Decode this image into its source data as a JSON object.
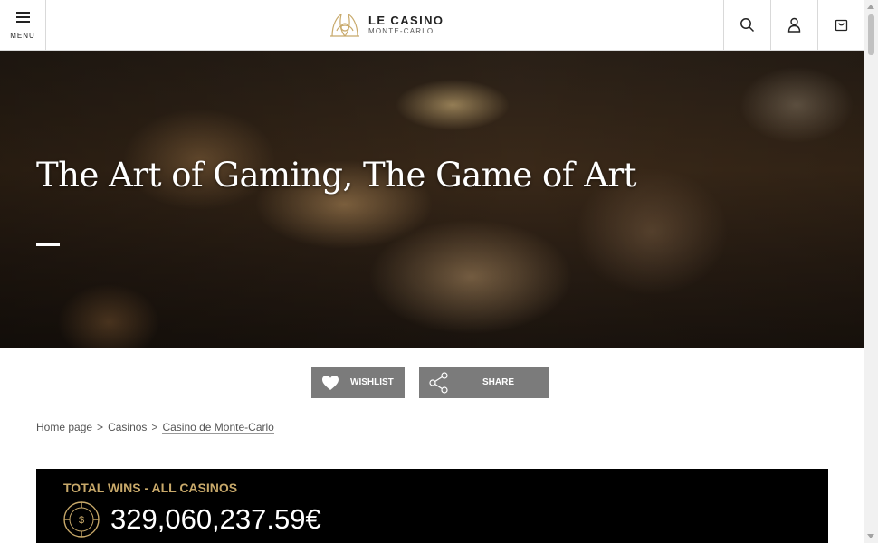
{
  "header": {
    "menu_label": "MENU",
    "logo_title": "LE CASINO",
    "logo_subtitle": "MONTE-CARLO",
    "icons": [
      "search-icon",
      "user-icon",
      "bag-icon"
    ]
  },
  "hero": {
    "title": "The Art of Gaming, The Game of Art"
  },
  "actions": {
    "wishlist_label": "WISHLIST",
    "share_label": "SHARE"
  },
  "breadcrumb": {
    "items": [
      "Home page",
      "Casinos",
      "Casino de Monte-Carlo"
    ],
    "separator": ">"
  },
  "wins": {
    "title": "TOTAL WINS - ALL CASINOS",
    "amount": "329,060,237.59€"
  },
  "colors": {
    "gold": "#c8a96a",
    "button_gray": "#7b7b7b",
    "wins_bg": "#000000"
  }
}
